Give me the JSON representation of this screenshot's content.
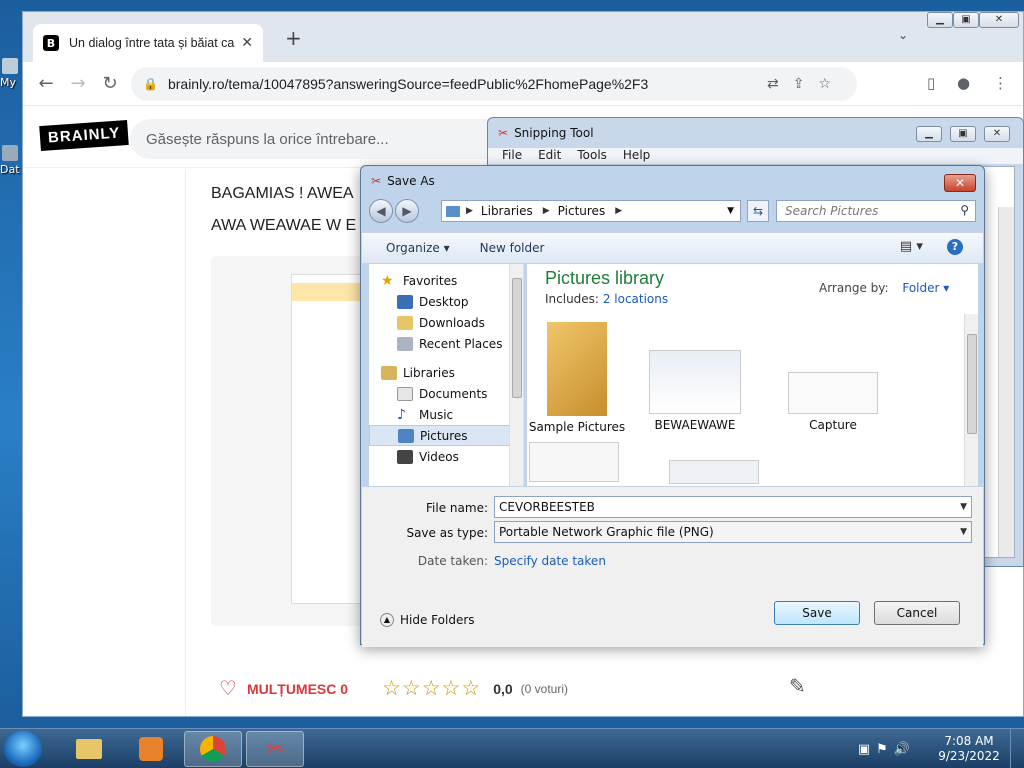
{
  "desktop": {
    "icons": [
      {
        "label": "My"
      },
      {
        "label": "Dat"
      }
    ]
  },
  "browser": {
    "tab": {
      "title": "Un dialog între tata și băiat ca nu"
    },
    "new_tab": "+",
    "address": "brainly.ro/tema/10047895?answeringSource=feedPublic%2FhomePage%2F3"
  },
  "brainly": {
    "logo": "BRAINLY",
    "search_placeholder": "Găsește răspuns la orice întrebare...",
    "answer_lines": [
      "BAGAMIAS ! AWEA",
      "AWA WEAWAE W E"
    ],
    "thanks_label": "MULȚUMESC 0",
    "rating_value": "0,0",
    "votes": "(0 voturi)",
    "rating_stars": 0
  },
  "snipping_tool": {
    "title": "Snipping Tool",
    "menu": [
      "File",
      "Edit",
      "Tools",
      "Help"
    ]
  },
  "save_dialog": {
    "title": "Save As",
    "breadcrumbs": [
      "Libraries",
      "Pictures"
    ],
    "search_placeholder": "Search Pictures",
    "organize": "Organize ▾",
    "new_folder": "New folder",
    "nav": {
      "favorites": "Favorites",
      "desktop": "Desktop",
      "downloads": "Downloads",
      "recent": "Recent Places",
      "libraries": "Libraries",
      "documents": "Documents",
      "music": "Music",
      "pictures": "Pictures",
      "videos": "Videos"
    },
    "library_title": "Pictures library",
    "includes_label": "Includes:",
    "includes_link": "2 locations",
    "arrange_label": "Arrange by:",
    "arrange_value": "Folder ▾",
    "items": [
      {
        "name": "Sample Pictures"
      },
      {
        "name": "BEWAEWAWE"
      },
      {
        "name": "Capture"
      }
    ],
    "file_name_label": "File name:",
    "file_name_value": "CEVORBEESTEB",
    "save_type_label": "Save as type:",
    "save_type_value": "Portable Network Graphic file (PNG)",
    "date_label": "Date taken:",
    "date_link": "Specify date taken",
    "hide_folders": "Hide Folders",
    "save": "Save",
    "cancel": "Cancel"
  },
  "taskbar": {
    "time": "7:08 AM",
    "date": "9/23/2022"
  }
}
